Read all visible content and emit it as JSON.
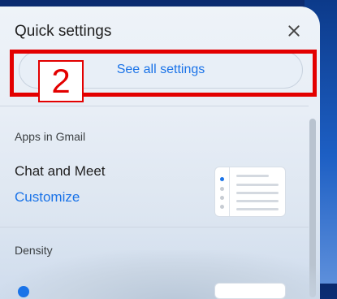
{
  "panel": {
    "title": "Quick settings",
    "see_all_label": "See all settings",
    "annotation_number": "2"
  },
  "apps_section": {
    "heading": "Apps in Gmail",
    "row_label": "Chat and Meet",
    "link_label": "Customize"
  },
  "density_section": {
    "heading": "Density"
  },
  "colors": {
    "accent": "#1a73e8",
    "annotation": "#e30000"
  },
  "icons": {
    "close": "close-icon",
    "preview": "chat-meet-preview-icon"
  }
}
